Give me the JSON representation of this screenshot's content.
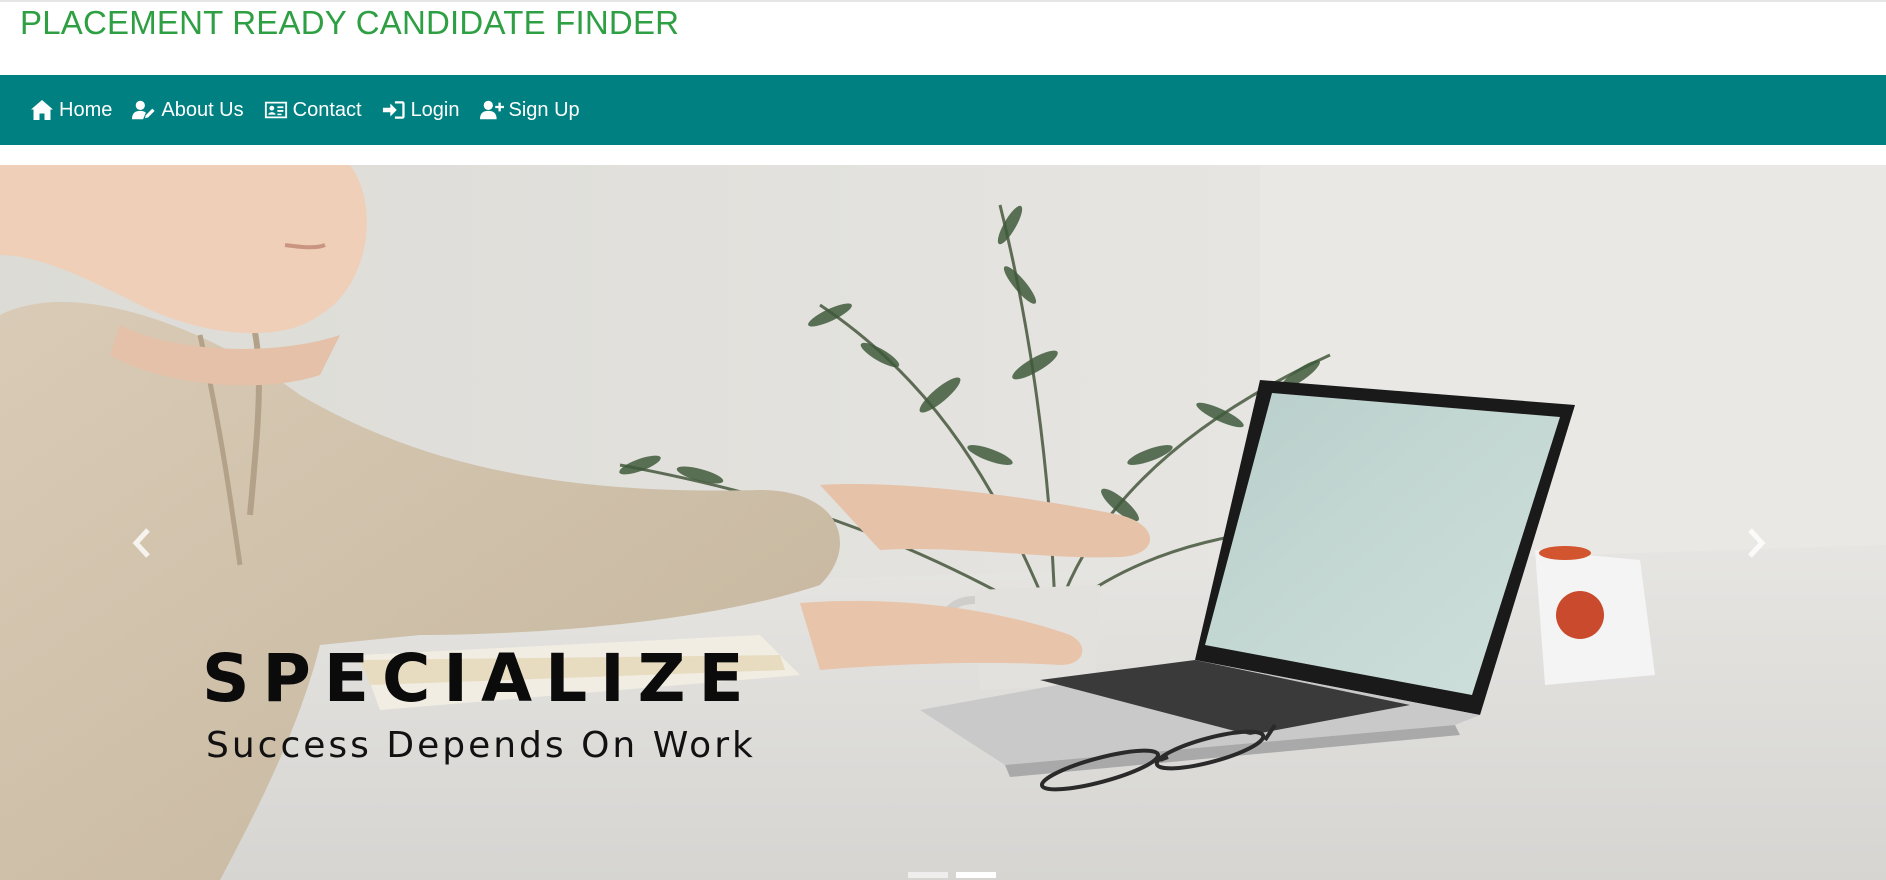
{
  "header": {
    "brand_title": "PLACEMENT READY CANDIDATE FINDER",
    "brand_color": "#2ea043"
  },
  "navbar": {
    "background": "#008080",
    "items": [
      {
        "label": "Home",
        "icon": "home-icon"
      },
      {
        "label": "About Us",
        "icon": "user-edit-icon"
      },
      {
        "label": "Contact",
        "icon": "address-card-icon"
      },
      {
        "label": "Login",
        "icon": "sign-in-icon"
      },
      {
        "label": "Sign Up",
        "icon": "user-plus-icon"
      }
    ]
  },
  "hero": {
    "image": "person-typing-on-laptop-photo",
    "caption_title": "SPECIALIZE",
    "caption_subtitle": "Success Depends On Work",
    "prev_icon": "chevron-left-icon",
    "next_icon": "chevron-right-icon",
    "active_slide": 2
  }
}
